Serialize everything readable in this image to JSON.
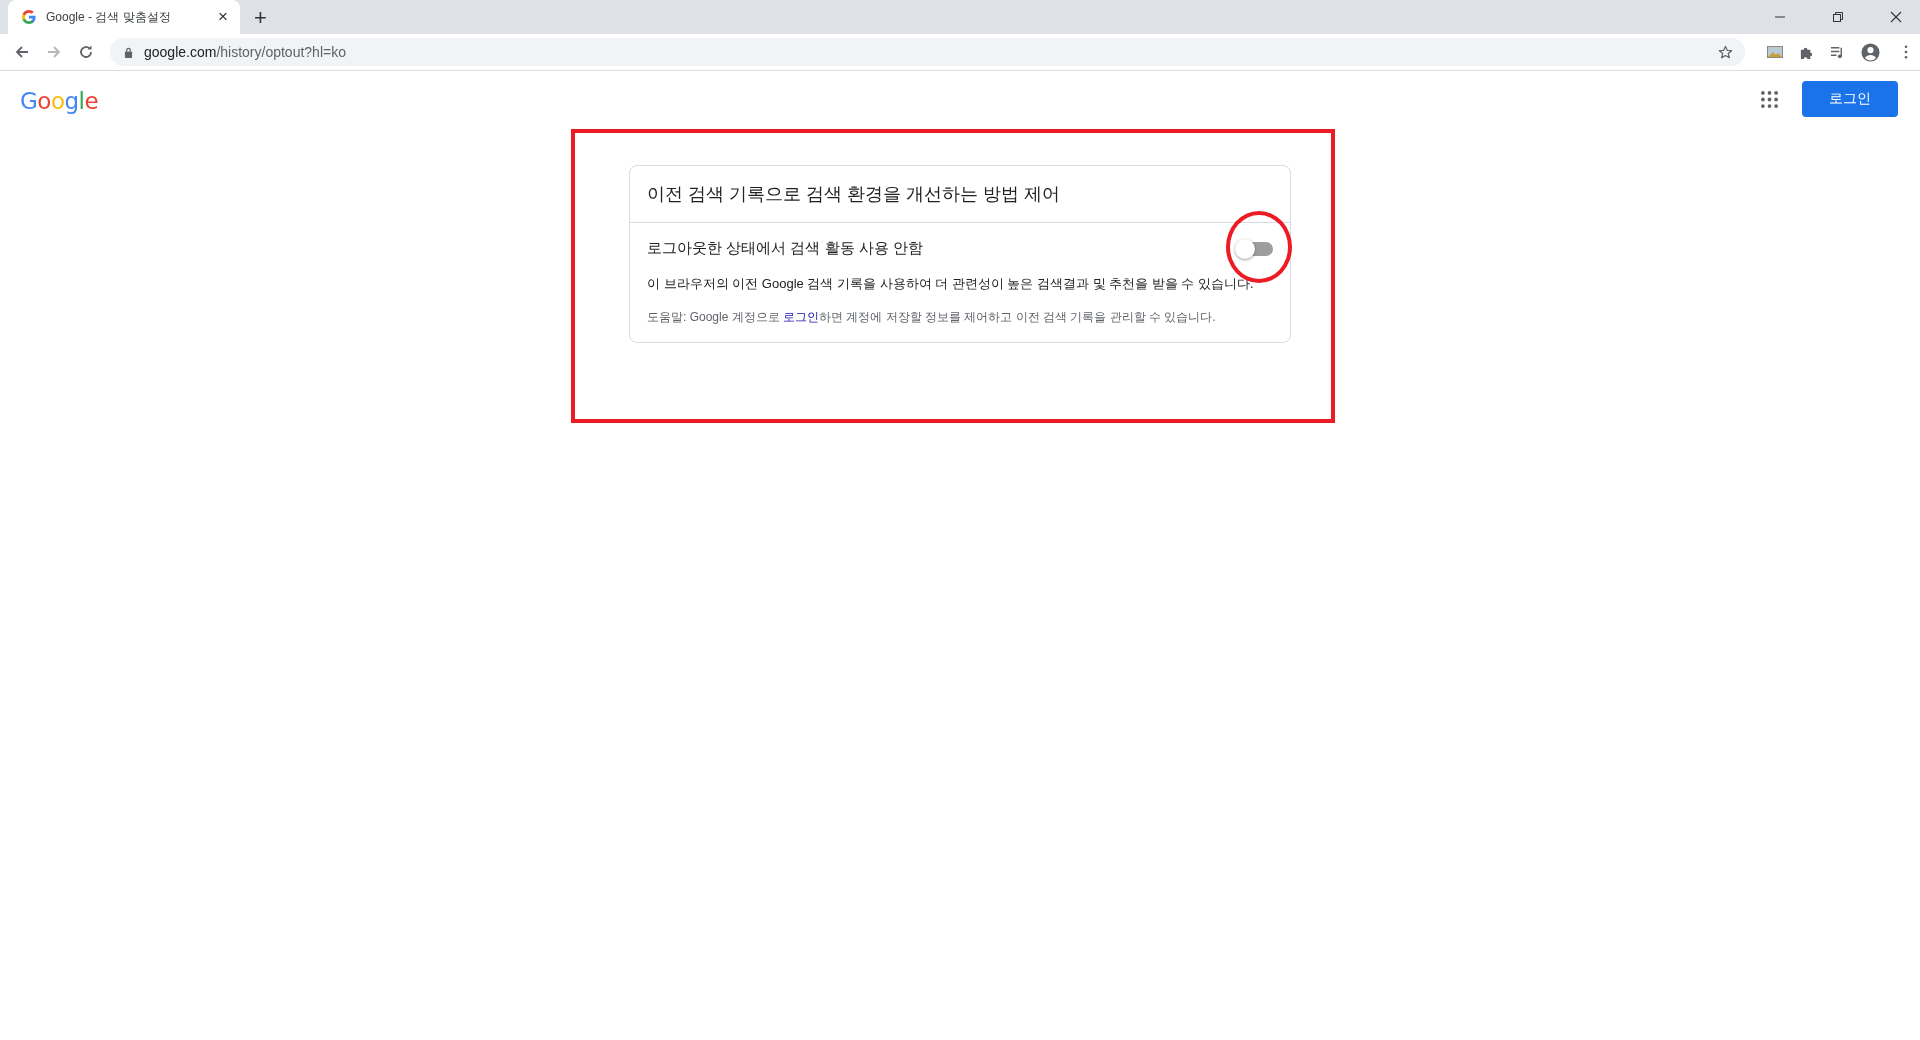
{
  "browser": {
    "tab": {
      "title": "Google - 검색 맞춤설정",
      "close": "×"
    },
    "new_tab": "+",
    "address": {
      "host": "google.com",
      "path": "/history/optout?hl=ko"
    }
  },
  "header": {
    "logo": "Google",
    "login_button": "로그인"
  },
  "card": {
    "title": "이전 검색 기록으로 검색 환경을 개선하는 방법 제어",
    "setting": {
      "label": "로그아웃한 상태에서 검색 활동 사용 안함",
      "on": false
    },
    "description": "이 브라우저의 이전 Google 검색 기록을 사용하여 더 관련성이 높은 검색결과 및 추천을 받을 수 있습니다.",
    "help": {
      "before": "도움말: Google 계정으로 ",
      "link": "로그인",
      "after": "하면 계정에 저장할 정보를 제어하고 이전 검색 기록을 관리할 수 있습니다."
    }
  }
}
